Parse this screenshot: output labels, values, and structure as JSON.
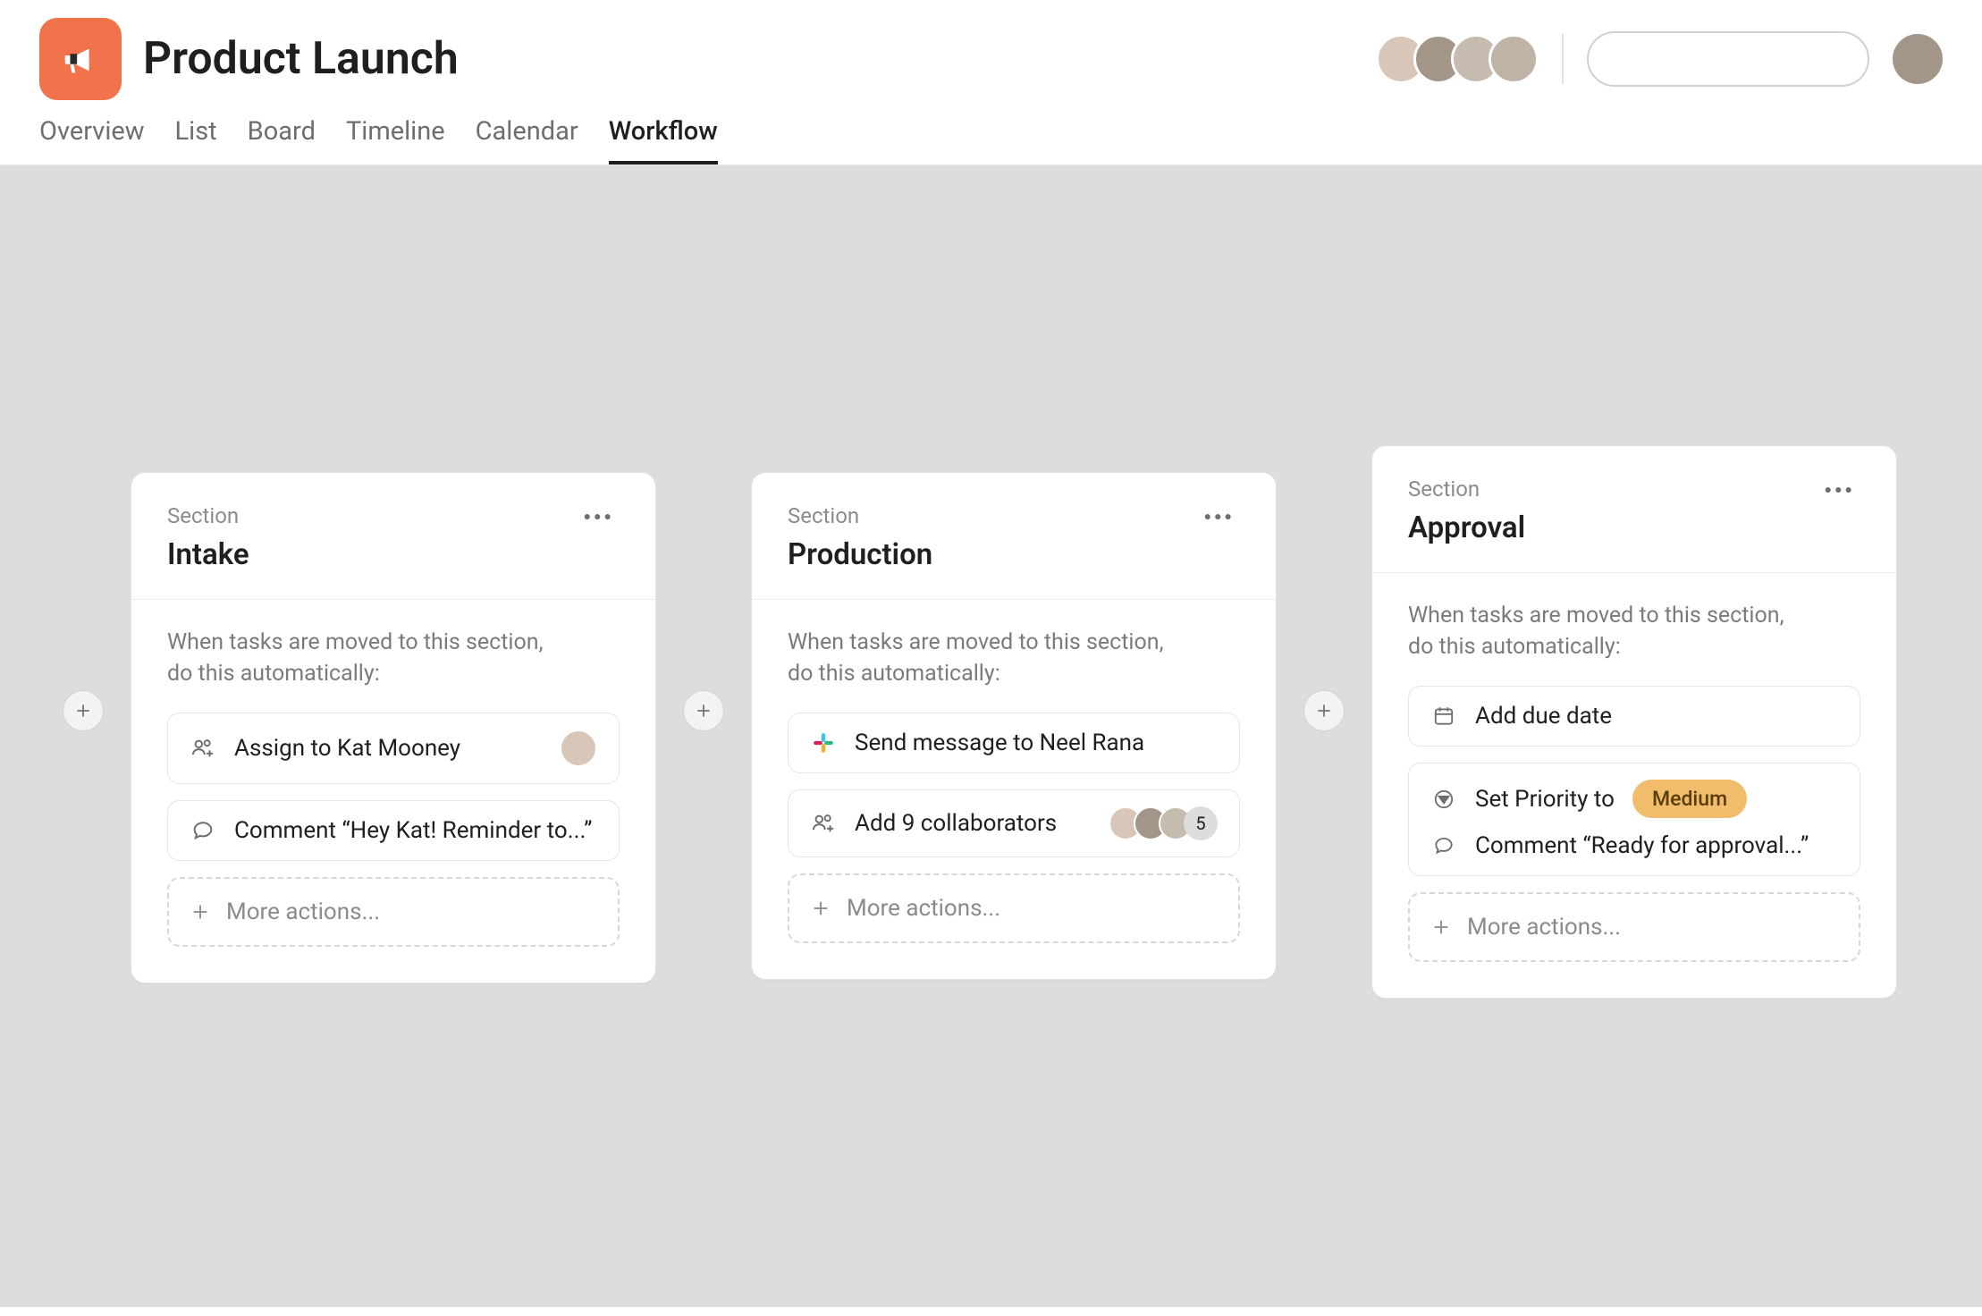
{
  "header": {
    "title": "Product Launch",
    "search_placeholder": ""
  },
  "tabs": [
    "Overview",
    "List",
    "Board",
    "Timeline",
    "Calendar",
    "Workflow"
  ],
  "active_tab": "Workflow",
  "section_label": "Section",
  "trigger_text_l1": "When tasks are moved to this section,",
  "trigger_text_l2": "do this automatically:",
  "more_actions_label": "More actions...",
  "cards": [
    {
      "name": "Intake",
      "rules": [
        {
          "type": "assign",
          "text": "Assign to Kat Mooney"
        },
        {
          "type": "comment",
          "text": "Comment “Hey Kat! Reminder to...”"
        }
      ]
    },
    {
      "name": "Production",
      "rules": [
        {
          "type": "slack",
          "text": "Send message to Neel Rana"
        },
        {
          "type": "collab",
          "text": "Add 9 collaborators",
          "extra_count": "5"
        }
      ]
    },
    {
      "name": "Approval",
      "rules": [
        {
          "type": "duedate",
          "text": "Add due date"
        },
        {
          "type": "priority_comment",
          "text1": "Set Priority to",
          "badge": "Medium",
          "text2": "Comment “Ready for approval...”"
        }
      ]
    }
  ]
}
